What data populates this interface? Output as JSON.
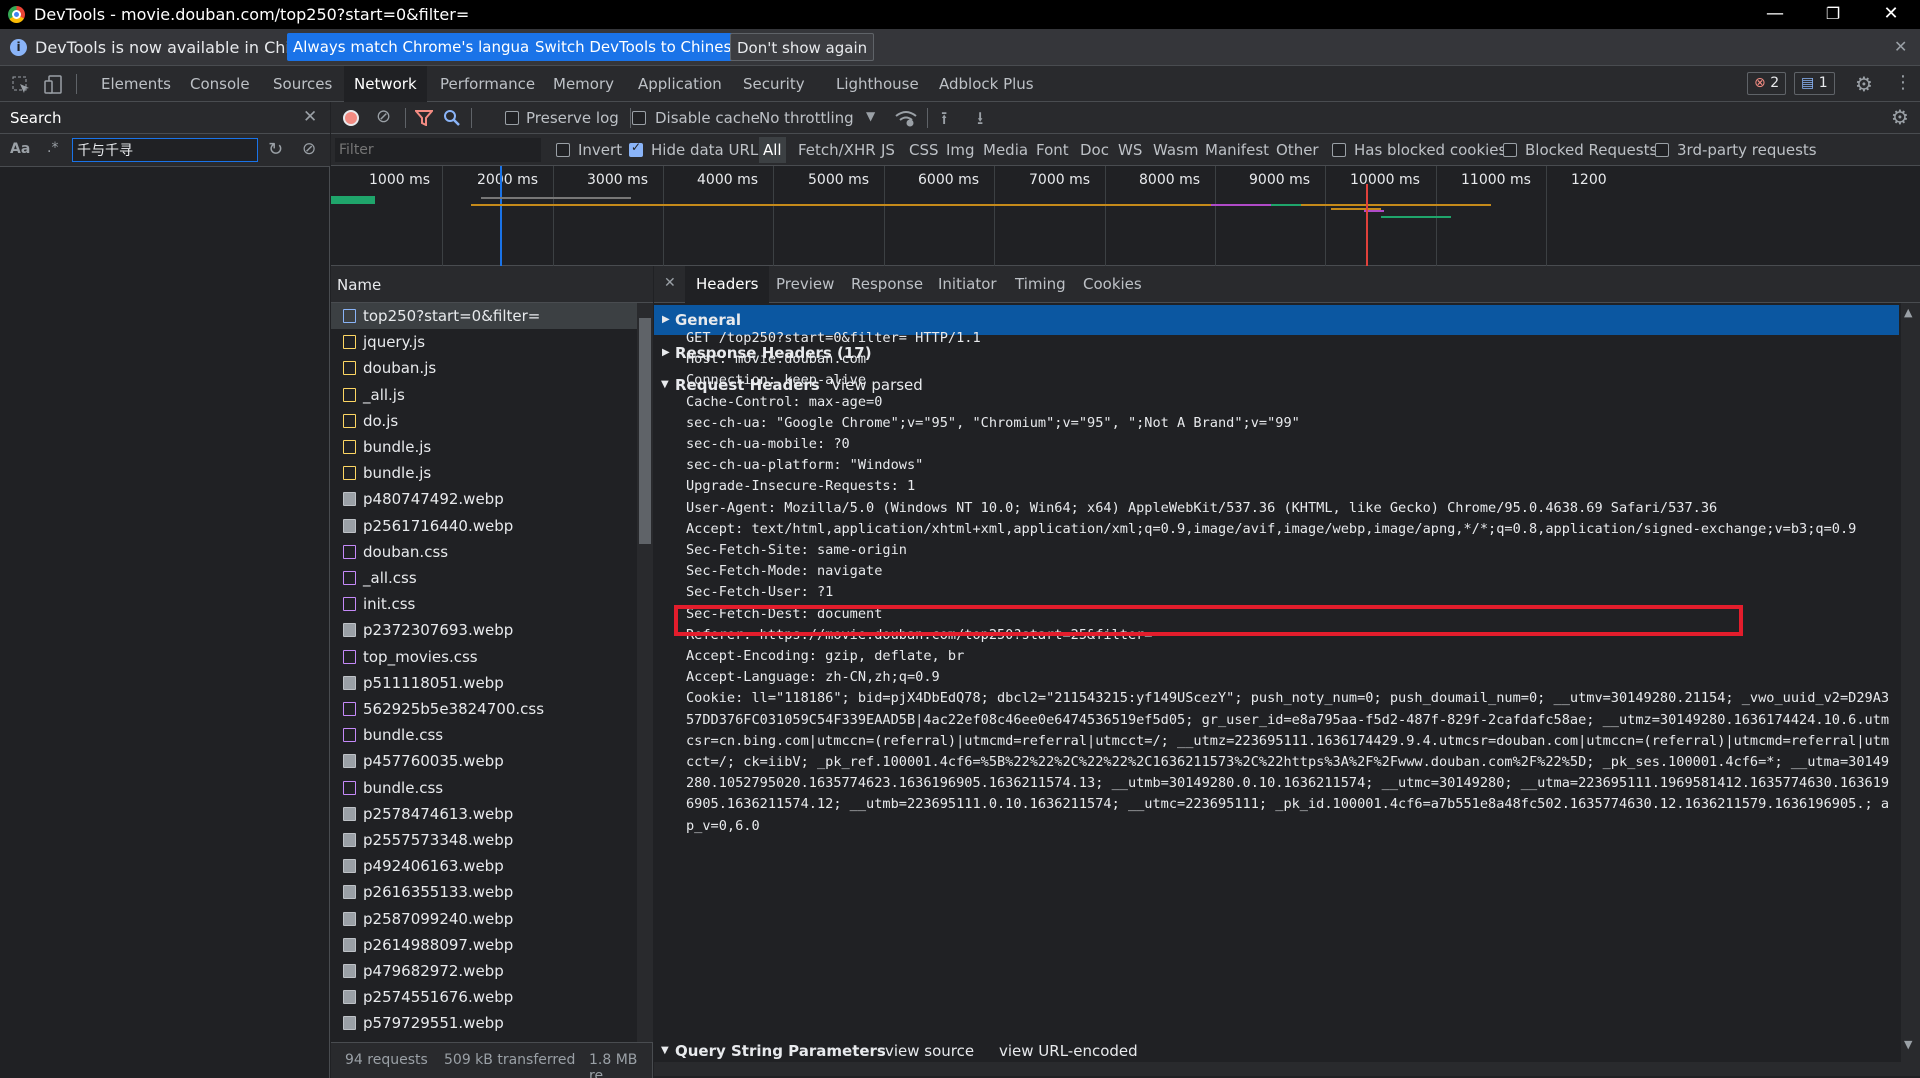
{
  "titlebar": {
    "title": "DevTools - movie.douban.com/top250?start=0&filter="
  },
  "infobar": {
    "message": "DevTools is now available in Chinese!",
    "btn_match": "Always match Chrome's language",
    "btn_switch": "Switch DevTools to Chinese",
    "btn_dont": "Don't show again"
  },
  "tabs": [
    "Elements",
    "Console",
    "Sources",
    "Network",
    "Performance",
    "Memory",
    "Application",
    "Security",
    "Lighthouse",
    "Adblock Plus"
  ],
  "badges": {
    "errors": "2",
    "messages": "1"
  },
  "search": {
    "title": "Search",
    "case_label": "Aa",
    "regex_label": ".*",
    "query": "千与千寻"
  },
  "toolbar": {
    "preserve_log": "Preserve log",
    "disable_cache": "Disable cache",
    "throttling": "No throttling"
  },
  "filter": {
    "placeholder": "Filter",
    "invert": "Invert",
    "hide_data_urls": "Hide data URLs",
    "types": [
      "All",
      "Fetch/XHR",
      "JS",
      "CSS",
      "Img",
      "Media",
      "Font",
      "Doc",
      "WS",
      "Wasm",
      "Manifest",
      "Other"
    ],
    "has_blocked": "Has blocked cookies",
    "blocked_requests": "Blocked Requests",
    "third_party": "3rd-party requests"
  },
  "timeline": {
    "ticks": [
      "1000 ms",
      "2000 ms",
      "3000 ms",
      "4000 ms",
      "5000 ms",
      "6000 ms",
      "7000 ms",
      "8000 ms",
      "9000 ms",
      "10000 ms",
      "11000 ms",
      "1200"
    ]
  },
  "requests": {
    "header": "Name",
    "items": [
      {
        "name": "top250?start=0&filter=",
        "type": "doc"
      },
      {
        "name": "jquery.js",
        "type": "js"
      },
      {
        "name": "douban.js",
        "type": "js"
      },
      {
        "name": "_all.js",
        "type": "js"
      },
      {
        "name": "do.js",
        "type": "js"
      },
      {
        "name": "bundle.js",
        "type": "js"
      },
      {
        "name": "bundle.js",
        "type": "js"
      },
      {
        "name": "p480747492.webp",
        "type": "img"
      },
      {
        "name": "p2561716440.webp",
        "type": "img"
      },
      {
        "name": "douban.css",
        "type": "css"
      },
      {
        "name": "_all.css",
        "type": "css"
      },
      {
        "name": "init.css",
        "type": "css"
      },
      {
        "name": "p2372307693.webp",
        "type": "img"
      },
      {
        "name": "top_movies.css",
        "type": "css"
      },
      {
        "name": "p511118051.webp",
        "type": "img"
      },
      {
        "name": "562925b5e3824700.css",
        "type": "css"
      },
      {
        "name": "bundle.css",
        "type": "css"
      },
      {
        "name": "p457760035.webp",
        "type": "img"
      },
      {
        "name": "bundle.css",
        "type": "css"
      },
      {
        "name": "p2578474613.webp",
        "type": "img"
      },
      {
        "name": "p2557573348.webp",
        "type": "img"
      },
      {
        "name": "p492406163.webp",
        "type": "img"
      },
      {
        "name": "p2616355133.webp",
        "type": "img"
      },
      {
        "name": "p2587099240.webp",
        "type": "img"
      },
      {
        "name": "p2614988097.webp",
        "type": "img"
      },
      {
        "name": "p479682972.webp",
        "type": "img"
      },
      {
        "name": "p2574551676.webp",
        "type": "img"
      },
      {
        "name": "p579729551.webp",
        "type": "img"
      }
    ]
  },
  "status": {
    "requests": "94 requests",
    "transferred": "509 kB transferred",
    "resources": "1.8 MB re"
  },
  "detail": {
    "tabs": [
      "Headers",
      "Preview",
      "Response",
      "Initiator",
      "Timing",
      "Cookies"
    ],
    "general": "General",
    "response_headers": "Response Headers (17)",
    "request_headers": "Request Headers",
    "view_parsed": "View parsed",
    "lines": [
      "GET /top250?start=0&filter= HTTP/1.1",
      "Host: movie.douban.com",
      "Connection: keep-alive",
      "Cache-Control: max-age=0",
      "sec-ch-ua: \"Google Chrome\";v=\"95\", \"Chromium\";v=\"95\", \";Not A Brand\";v=\"99\"",
      "sec-ch-ua-mobile: ?0",
      "sec-ch-ua-platform: \"Windows\"",
      "Upgrade-Insecure-Requests: 1",
      "User-Agent: Mozilla/5.0 (Windows NT 10.0; Win64; x64) AppleWebKit/537.36 (KHTML, like Gecko) Chrome/95.0.4638.69 Safari/537.36",
      "Accept: text/html,application/xhtml+xml,application/xml;q=0.9,image/avif,image/webp,image/apng,*/*;q=0.8,application/signed-exchange;v=b3;q=0.9",
      "Sec-Fetch-Site: same-origin",
      "Sec-Fetch-Mode: navigate",
      "Sec-Fetch-User: ?1",
      "Sec-Fetch-Dest: document",
      "Referer: https://movie.douban.com/top250?start=25&filter=",
      "Accept-Encoding: gzip, deflate, br",
      "Accept-Language: zh-CN,zh;q=0.9",
      "Cookie: ll=\"118186\"; bid=pjX4DbEdQ78; dbcl2=\"211543215:yf149UScezY\"; push_noty_num=0; push_doumail_num=0; __utmv=30149280.21154; _vwo_uuid_v2=D29A3",
      "57DD376FC031059C54F339EAAD5B|4ac22ef08c46ee0e6474536519ef5d05; gr_user_id=e8a795aa-f5d2-487f-829f-2cafdafc58ae; __utmz=30149280.1636174424.10.6.utm",
      "csr=cn.bing.com|utmccn=(referral)|utmcmd=referral|utmcct=/; __utmz=223695111.1636174429.9.4.utmcsr=douban.com|utmccn=(referral)|utmcmd=referral|utm",
      "cct=/; ck=iibV; _pk_ref.100001.4cf6=%5B%22%22%2C%22%22%2C1636211573%2C%22https%3A%2F%2Fwww.douban.com%2F%22%5D; _pk_ses.100001.4cf6=*; __utma=30149",
      "280.1052795020.1635774623.1636196905.1636211574.13; __utmb=30149280.0.10.1636211574; __utmc=30149280; __utma=223695111.1969581412.1635774630.163619",
      "6905.1636211574.12; __utmb=223695111.0.10.1636211574; __utmc=223695111; _pk_id.100001.4cf6=a7b551e8a48fc502.1635774630.12.1636211579.1636196905.; a",
      "p_v=0,6.0"
    ],
    "query_params": "Query String Parameters",
    "view_source": "view source",
    "view_url_encoded": "view URL-encoded"
  },
  "colors": {
    "accent": "#1a73e8",
    "highlight": "#e31d2c",
    "section_selected": "#0b57a1"
  }
}
